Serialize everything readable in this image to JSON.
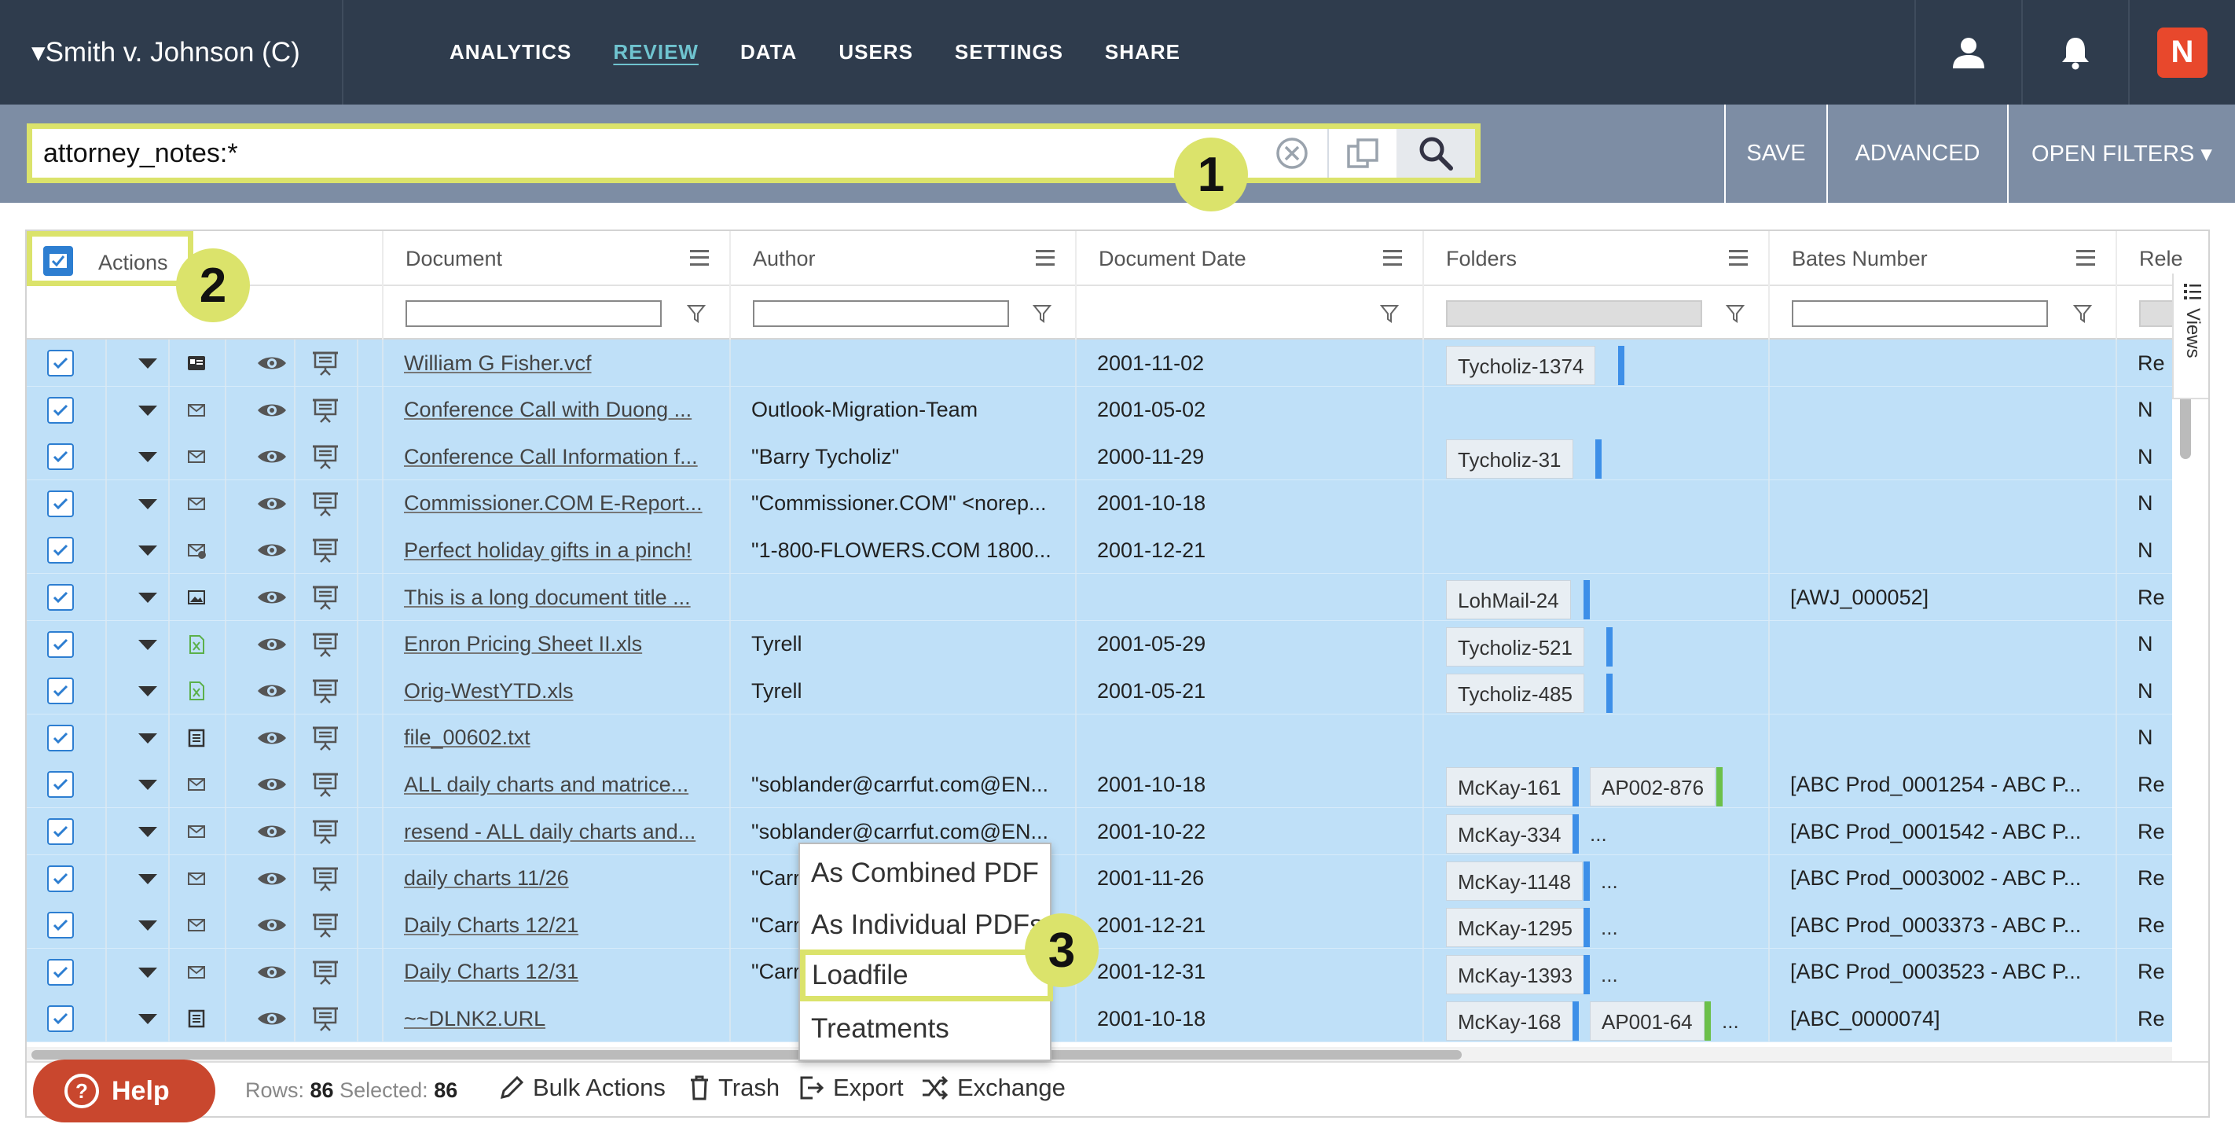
{
  "app": {
    "case_title": "▾Smith v. Johnson (C)",
    "nav": [
      "ANALYTICS",
      "REVIEW",
      "DATA",
      "USERS",
      "SETTINGS",
      "SHARE"
    ],
    "active_nav": "REVIEW",
    "logo_letter": "N",
    "accent": "#dbe36b",
    "brand": "#e8482c"
  },
  "search": {
    "query": "attorney_notes:*",
    "save_label": "SAVE",
    "advanced_label": "ADVANCED",
    "open_filters_label": "OPEN FILTERS ▾"
  },
  "callouts": [
    "1",
    "2",
    "3"
  ],
  "grid": {
    "actions_label": "Actions",
    "columns": [
      "Document",
      "Author",
      "Document Date",
      "Folders",
      "Bates Number",
      "Rele"
    ],
    "views_label": "Views",
    "rows": [
      {
        "doc": "William G Fisher.vcf",
        "author": "",
        "date": "2001-11-02",
        "folders": [
          {
            "name": "Tycholiz-1374",
            "color": "#3d8fe8"
          }
        ],
        "more": false,
        "bates": "",
        "rel": "Re",
        "icon": "contact-card-icon"
      },
      {
        "doc": "Conference Call with Duong ...",
        "author": "Outlook-Migration-Team",
        "date": "2001-05-02",
        "folders": [],
        "more": false,
        "bates": "",
        "rel": "N",
        "icon": "email-icon"
      },
      {
        "doc": "Conference Call Information f...",
        "author": "\"Barry Tycholiz\"",
        "date": "2000-11-29",
        "folders": [
          {
            "name": "Tycholiz-31",
            "color": "#3d8fe8"
          }
        ],
        "more": false,
        "bates": "",
        "rel": "N",
        "icon": "email-icon"
      },
      {
        "doc": "Commissioner.COM E-Report...",
        "author": "\"Commissioner.COM\" <norep...",
        "date": "2001-10-18",
        "folders": [],
        "more": false,
        "bates": "",
        "rel": "N",
        "icon": "email-icon"
      },
      {
        "doc": "Perfect holiday gifts in a pinch!",
        "author": "\"1-800-FLOWERS.COM 1800...",
        "date": "2001-12-21",
        "folders": [],
        "more": false,
        "bates": "",
        "rel": "N",
        "icon": "email-attachment-icon"
      },
      {
        "doc": "This is a long document title ...",
        "author": "",
        "date": "",
        "folders": [
          {
            "name": "LohMail-24",
            "color": "#3d8fe8"
          }
        ],
        "more": false,
        "bates": "[AWJ_000052]",
        "rel": "Re",
        "icon": "image-icon"
      },
      {
        "doc": "Enron Pricing Sheet II.xls",
        "author": "Tyrell",
        "date": "2001-05-29",
        "folders": [
          {
            "name": "Tycholiz-521",
            "color": "#3d8fe8"
          }
        ],
        "more": false,
        "bates": "",
        "rel": "N",
        "icon": "spreadsheet-icon"
      },
      {
        "doc": "Orig-WestYTD.xls",
        "author": "Tyrell",
        "date": "2001-05-21",
        "folders": [
          {
            "name": "Tycholiz-485",
            "color": "#3d8fe8"
          }
        ],
        "more": false,
        "bates": "",
        "rel": "N",
        "icon": "spreadsheet-icon"
      },
      {
        "doc": "file_00602.txt",
        "author": "",
        "date": "",
        "folders": [],
        "more": false,
        "bates": "",
        "rel": "N",
        "icon": "text-file-icon"
      },
      {
        "doc": "ALL daily charts and matrice...",
        "author": "\"soblander@carrfut.com@EN...",
        "date": "2001-10-18",
        "folders": [
          {
            "name": "McKay-161",
            "color": "#3d8fe8"
          },
          {
            "name": "AP002-876",
            "color": "#6cc04a"
          }
        ],
        "more": false,
        "bates": "[ABC Prod_0001254 - ABC P...",
        "rel": "Re",
        "icon": "email-icon"
      },
      {
        "doc": "resend - ALL daily charts and...",
        "author": "\"soblander@carrfut.com@EN...",
        "date": "2001-10-22",
        "folders": [
          {
            "name": "McKay-334",
            "color": "#3d8fe8"
          }
        ],
        "more": true,
        "bates": "[ABC Prod_0001542 - ABC P...",
        "rel": "Re",
        "icon": "email-icon"
      },
      {
        "doc": "daily charts 11/26",
        "author": "\"Carr",
        "date": "2001-11-26",
        "folders": [
          {
            "name": "McKay-1148",
            "color": "#3d8fe8"
          }
        ],
        "more": true,
        "bates": "[ABC Prod_0003002 - ABC P...",
        "rel": "Re",
        "icon": "email-icon"
      },
      {
        "doc": "Daily Charts 12/21",
        "author": "\"Carr",
        "date": "2001-12-21",
        "folders": [
          {
            "name": "McKay-1295",
            "color": "#3d8fe8"
          }
        ],
        "more": true,
        "bates": "[ABC Prod_0003373 - ABC P...",
        "rel": "Re",
        "icon": "email-icon"
      },
      {
        "doc": "Daily Charts 12/31",
        "author": "\"Carr",
        "date": "2001-12-31",
        "folders": [
          {
            "name": "McKay-1393",
            "color": "#3d8fe8"
          }
        ],
        "more": true,
        "bates": "[ABC Prod_0003523 - ABC P...",
        "rel": "Re",
        "icon": "email-icon"
      },
      {
        "doc": "~~DLNK2.URL",
        "author": "",
        "date": "2001-10-18",
        "folders": [
          {
            "name": "McKay-168",
            "color": "#3d8fe8"
          },
          {
            "name": "AP001-64",
            "color": "#6cc04a"
          }
        ],
        "more": true,
        "bates": "[ABC_0000074]",
        "rel": "Re",
        "icon": "text-file-icon"
      }
    ]
  },
  "footer": {
    "help_label": "Help",
    "rows_label": "Rows:",
    "rows_value": "86",
    "selected_label": "Selected:",
    "selected_value": "86",
    "bulk_actions": "Bulk Actions",
    "trash": "Trash",
    "export": "Export",
    "exchange": "Exchange"
  },
  "export_menu": {
    "items": [
      "As Combined PDF",
      "As Individual PDFs",
      "Loadfile",
      "Treatments"
    ],
    "highlighted": "Loadfile"
  }
}
